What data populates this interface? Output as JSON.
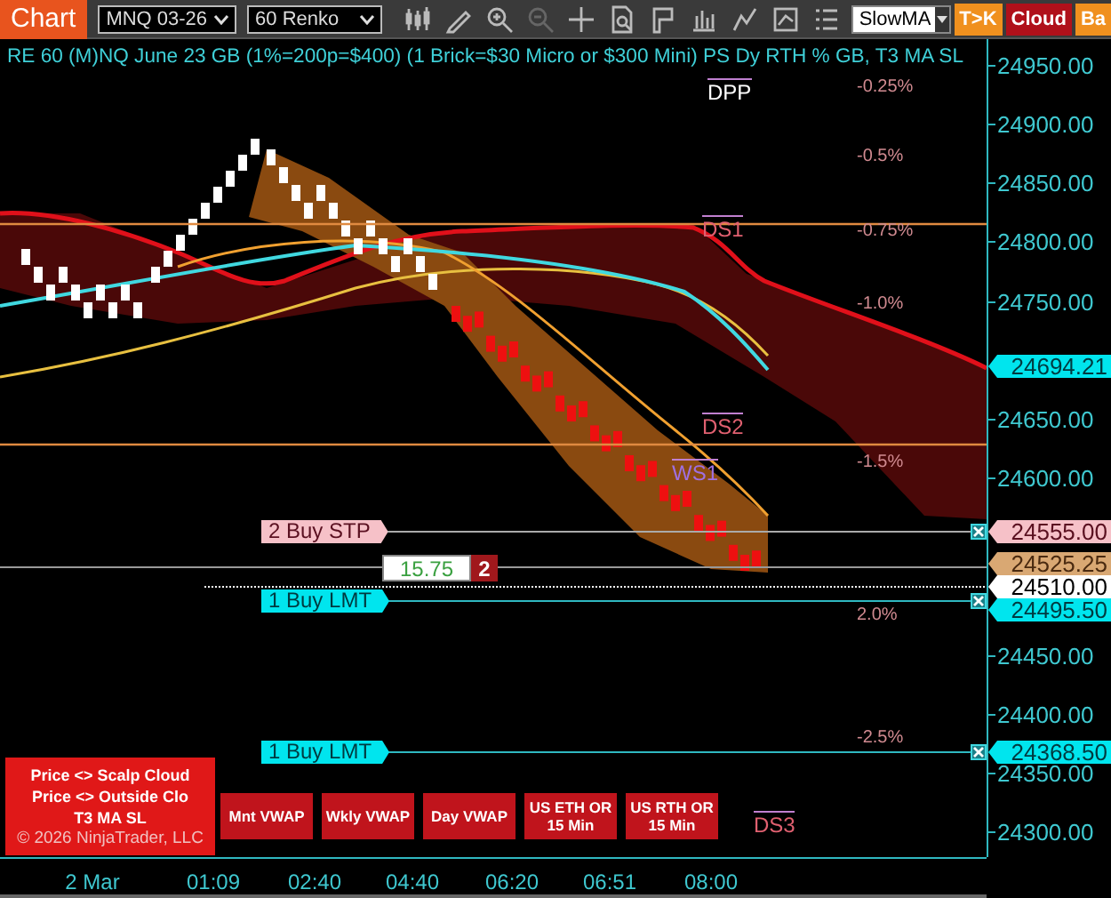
{
  "toolbar": {
    "tab": "Chart",
    "instrument": "MNQ 03-26",
    "bar_type": "60 Renko",
    "template": "SlowMA",
    "buttons": [
      {
        "label": "T>K",
        "color": "#f0901e"
      },
      {
        "label": "Cloud",
        "color": "#b0101a"
      },
      {
        "label": "Ba",
        "color": "#f0901e"
      }
    ]
  },
  "chart": {
    "title": "RE 60 (M)NQ June 23 GB (1%=200p=$400) (1 Brick=$30 Micro or $300 Mini) PS Dy RTH % GB, T3 MA SL",
    "level_labels": [
      {
        "text": "DPP",
        "kind": "pivot"
      },
      {
        "text": "DS1",
        "kind": "support"
      },
      {
        "text": "DS2",
        "kind": "support"
      },
      {
        "text": "WS1",
        "kind": "weekly"
      },
      {
        "text": "DS3",
        "kind": "support"
      }
    ],
    "percent_labels": [
      "-0.25%",
      "-0.5%",
      "-0.75%",
      "-1.0%",
      "-1.5%",
      "2.0%",
      "-2.5%"
    ],
    "orders": [
      {
        "label": "2 Buy STP",
        "kind": "stop"
      },
      {
        "label": "1 Buy LMT",
        "kind": "limit"
      },
      {
        "label": "1 Buy LMT",
        "kind": "limit"
      }
    ],
    "position": {
      "profit": "15.75",
      "quantity": "2"
    },
    "signal_panel": [
      "Price <> Scalp Cloud",
      "Price <> Outside Clo",
      "T3 MA SL"
    ],
    "copyright": "© 2026 NinjaTrader, LLC",
    "indicator_buttons": [
      "Mnt VWAP",
      "Wkly VWAP",
      "Day VWAP",
      "US ETH OR 15 Min",
      "US RTH OR 15 Min"
    ]
  },
  "price_axis": {
    "ticks": [
      "24950.00",
      "24900.00",
      "24850.00",
      "24800.00",
      "24750.00",
      "24650.00",
      "24600.00",
      "24450.00",
      "24400.00",
      "24350.00",
      "24300.00"
    ],
    "markers": [
      {
        "text": "24694.21",
        "kind": "last"
      },
      {
        "text": "24555.00",
        "kind": "stop"
      },
      {
        "text": "24525.25",
        "kind": "target"
      },
      {
        "text": "24510.00",
        "kind": "current"
      },
      {
        "text": "24495.50",
        "kind": "limit"
      },
      {
        "text": "24368.50",
        "kind": "limit"
      }
    ]
  },
  "time_axis": [
    "2 Mar",
    "01:09",
    "02:40",
    "04:40",
    "06:20",
    "06:51",
    "08:00"
  ]
}
